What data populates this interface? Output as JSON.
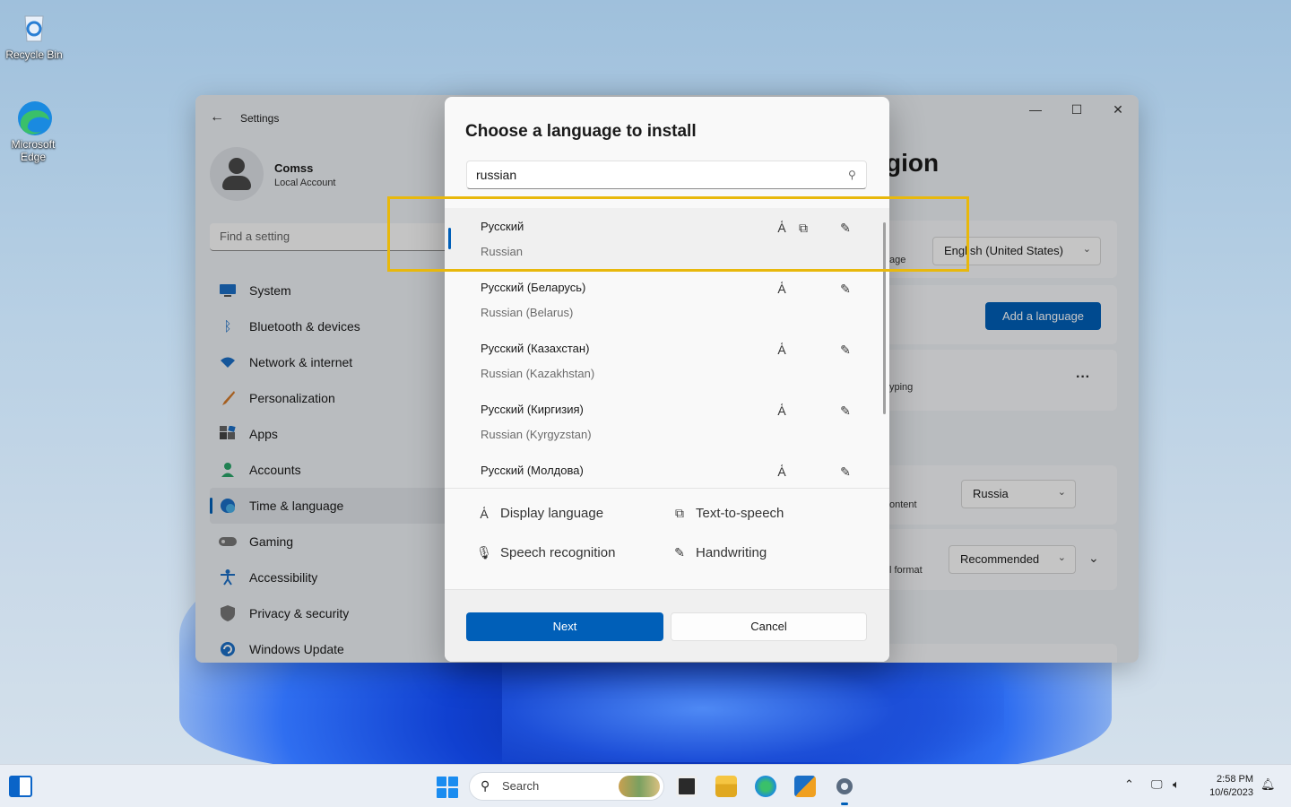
{
  "desktop": {
    "icons": [
      {
        "label": "Recycle Bin"
      },
      {
        "label": "Microsoft Edge"
      }
    ]
  },
  "settings": {
    "window_title": "Settings",
    "profile": {
      "name": "Comss",
      "subtitle": "Local Account"
    },
    "find_placeholder": "Find a setting",
    "nav": [
      {
        "label": "System",
        "icon": "monitor-icon"
      },
      {
        "label": "Bluetooth & devices",
        "icon": "bluetooth-icon"
      },
      {
        "label": "Network & internet",
        "icon": "wifi-icon"
      },
      {
        "label": "Personalization",
        "icon": "brush-icon"
      },
      {
        "label": "Apps",
        "icon": "apps-icon"
      },
      {
        "label": "Accounts",
        "icon": "person-icon"
      },
      {
        "label": "Time & language",
        "icon": "globe-clock-icon",
        "active": true
      },
      {
        "label": "Gaming",
        "icon": "gamepad-icon"
      },
      {
        "label": "Accessibility",
        "icon": "accessibility-icon"
      },
      {
        "label": "Privacy & security",
        "icon": "shield-icon"
      },
      {
        "label": "Windows Update",
        "icon": "update-icon"
      }
    ],
    "page_title_partial": "gion",
    "display_language_label_partial": "age",
    "display_language_value": "English (United States)",
    "add_language_label": "Add a language",
    "typing_label_partial": "yping",
    "more_label": "···",
    "region_label_partial": "ontent",
    "region_value": "Russia",
    "format_label_partial": "l format",
    "format_value": "Recommended",
    "accent": "#005fb8"
  },
  "dialog": {
    "title": "Choose a language to install",
    "search_value": "russian",
    "languages": [
      {
        "native": "Русский",
        "english": "Russian",
        "selected": true,
        "features": [
          "display",
          "tts",
          "handwriting"
        ]
      },
      {
        "native": "Русский (Беларусь)",
        "english": "Russian (Belarus)",
        "features": [
          "display",
          "handwriting"
        ]
      },
      {
        "native": "Русский (Казахстан)",
        "english": "Russian (Kazakhstan)",
        "features": [
          "display",
          "handwriting"
        ]
      },
      {
        "native": "Русский (Киргизия)",
        "english": "Russian (Kyrgyzstan)",
        "features": [
          "display",
          "handwriting"
        ]
      },
      {
        "native": "Русский (Молдова)",
        "english": "",
        "features": [
          "display",
          "handwriting"
        ]
      }
    ],
    "legend": {
      "display": "Display language",
      "tts": "Text-to-speech",
      "speech": "Speech recognition",
      "handwriting": "Handwriting"
    },
    "next_label": "Next",
    "cancel_label": "Cancel"
  },
  "taskbar": {
    "search_label": "Search",
    "time": "2:58 PM",
    "date": "10/6/2023"
  },
  "highlight_color": "#e8b80c"
}
